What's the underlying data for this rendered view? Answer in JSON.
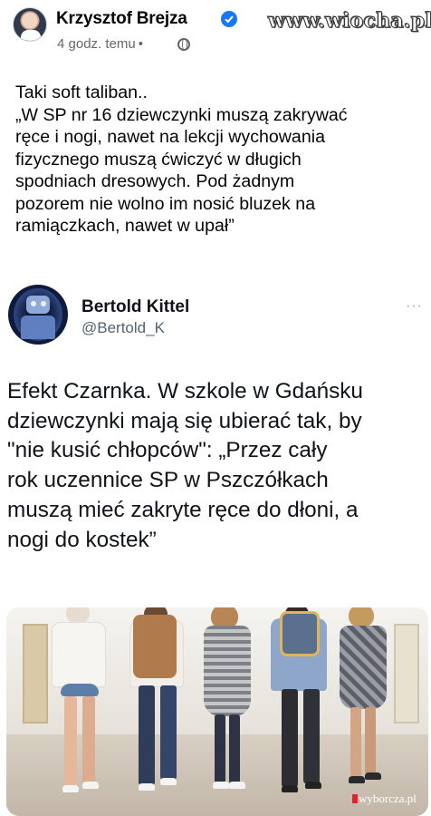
{
  "facebook_post": {
    "author_name": "Krzysztof Brejza",
    "timestamp": "4 godz. temu",
    "separator": "•",
    "verified_icon": "verified-badge-icon",
    "privacy_icon": "globe-icon",
    "watermark": "www.wiocha.pl",
    "text_lines": [
      "Taki soft taliban..",
      "„W SP nr 16 dziewczynki muszą zakrywać",
      "ręce i nogi, nawet na lekcji wychowania",
      "fizycznego muszą ćwiczyć w długich",
      "spodniach dresowych. Pod żadnym",
      "pozorem nie wolno im nosić bluzek na",
      "ramiączkach, nawet w upał”"
    ]
  },
  "tweet": {
    "display_name": "Bertold Kittel",
    "handle": "@Bertold_K",
    "more_icon": "more-options-icon",
    "more_glyph": "···",
    "text_lines": [
      "Efekt Czarnka. W szkole w Gdańsku",
      "dziewczynki mają się ubierać tak, by",
      "\"nie kusić chłopców\": „Przez cały",
      "rok uczennice SP w Pszczółkach",
      "muszą mieć zakryte ręce do dłoni, a",
      "nogi do kostek”"
    ],
    "photo_credit": "wyborcza.pl"
  },
  "colors": {
    "facebook_blue": "#1877f2",
    "meta_gray": "#65676b",
    "twitter_handle_gray": "#536471",
    "wyborcza_red": "#d8262c"
  }
}
